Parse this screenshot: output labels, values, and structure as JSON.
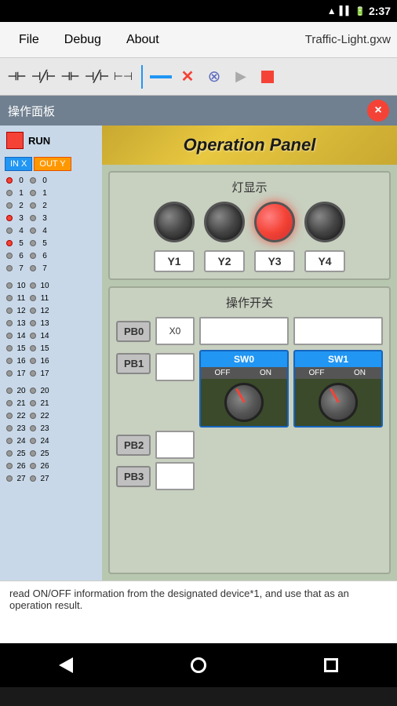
{
  "statusBar": {
    "time": "2:37",
    "icons": [
      "wifi",
      "signal",
      "battery"
    ]
  },
  "menuBar": {
    "items": [
      "File",
      "Debug",
      "About"
    ],
    "title": "Traffic-Light.gxw"
  },
  "toolbar": {
    "buttons": [
      "contact-no",
      "contact-nc",
      "contact-no2",
      "contact-nc2",
      "special",
      "divider",
      "line",
      "x-mark",
      "xx-mark",
      "play",
      "stop"
    ]
  },
  "windowTitle": "操作面板",
  "closeButton": "×",
  "runIndicator": "RUN",
  "ioHeaders": {
    "in": "IN X",
    "out": "OUT Y"
  },
  "ioRows": [
    {
      "num": 0,
      "inLed": "red",
      "outLed": "gray"
    },
    {
      "num": 1,
      "inLed": "gray",
      "outLed": "gray"
    },
    {
      "num": 2,
      "inLed": "gray",
      "outLed": "gray"
    },
    {
      "num": 3,
      "inLed": "red",
      "outLed": "gray"
    },
    {
      "num": 4,
      "inLed": "gray",
      "outLed": "gray"
    },
    {
      "num": 5,
      "inLed": "red",
      "outLed": "gray"
    },
    {
      "num": 6,
      "inLed": "gray",
      "outLed": "gray"
    },
    {
      "num": 7,
      "inLed": "gray",
      "outLed": "gray"
    },
    {
      "num": 10,
      "inLed": "gray",
      "outLed": "gray"
    },
    {
      "num": 11,
      "inLed": "gray",
      "outLed": "gray"
    },
    {
      "num": 12,
      "inLed": "gray",
      "outLed": "gray"
    },
    {
      "num": 13,
      "inLed": "gray",
      "outLed": "gray"
    },
    {
      "num": 14,
      "inLed": "gray",
      "outLed": "gray"
    },
    {
      "num": 15,
      "inLed": "gray",
      "outLed": "gray"
    },
    {
      "num": 16,
      "inLed": "gray",
      "outLed": "gray"
    },
    {
      "num": 17,
      "inLed": "gray",
      "outLed": "gray"
    },
    {
      "num": 20,
      "inLed": "gray",
      "outLed": "gray"
    },
    {
      "num": 21,
      "inLed": "gray",
      "outLed": "gray"
    },
    {
      "num": 22,
      "inLed": "gray",
      "outLed": "gray"
    },
    {
      "num": 23,
      "inLed": "gray",
      "outLed": "gray"
    },
    {
      "num": 24,
      "inLed": "gray",
      "outLed": "gray"
    },
    {
      "num": 25,
      "inLed": "gray",
      "outLed": "gray"
    },
    {
      "num": 26,
      "inLed": "gray",
      "outLed": "gray"
    },
    {
      "num": 27,
      "inLed": "gray",
      "outLed": "gray"
    }
  ],
  "operationPanel": {
    "title": "Operation Panel",
    "lightSection": {
      "title": "灯显示",
      "lights": [
        "off",
        "off",
        "red",
        "off"
      ],
      "labels": [
        "Y1",
        "Y2",
        "Y3",
        "Y4"
      ]
    },
    "switchSection": {
      "title": "操作开关",
      "buttons": [
        "PB0",
        "PB1",
        "PB2",
        "PB3"
      ],
      "inputs": [
        "X0",
        "",
        "",
        ""
      ],
      "switches": [
        {
          "label": "SW0",
          "off": "OFF",
          "on": "ON"
        },
        {
          "label": "SW1",
          "off": "OFF",
          "on": "ON"
        }
      ]
    }
  },
  "bottomText": "read ON/OFF information from the designated device*1, and use that as an operation result.",
  "navBar": {
    "back": "◀",
    "home": "●",
    "recents": "■"
  }
}
